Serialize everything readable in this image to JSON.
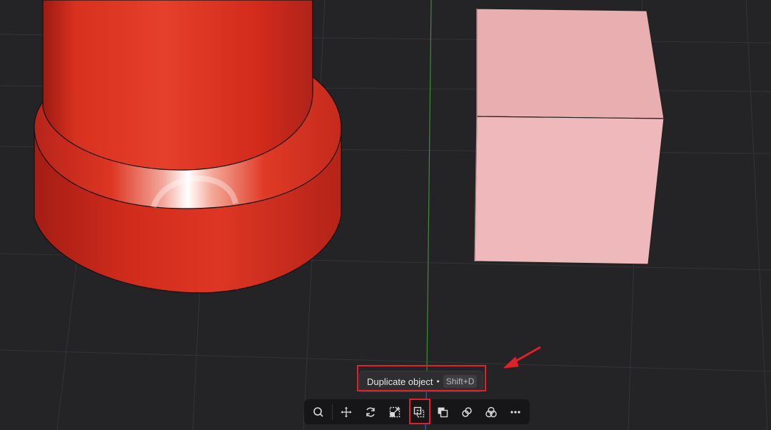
{
  "viewport": {
    "background_color": "#242426",
    "objects": [
      {
        "type": "cylinder-on-base",
        "color": "#e33a2a"
      },
      {
        "type": "cube",
        "color": "#f0b3b5"
      }
    ]
  },
  "tooltip": {
    "label": "Duplicate object",
    "separator": "•",
    "shortcut": "Shift+D"
  },
  "toolbar": {
    "buttons": [
      {
        "name": "search-button",
        "icon": "search-icon"
      },
      {
        "name": "move-button",
        "icon": "move-icon"
      },
      {
        "name": "rotate-button",
        "icon": "rotate-icon"
      },
      {
        "name": "scale-button",
        "icon": "scale-icon"
      },
      {
        "name": "duplicate-button",
        "icon": "duplicate-icon",
        "active": true
      },
      {
        "name": "boolean-button",
        "icon": "boolean-icon"
      },
      {
        "name": "link-button",
        "icon": "link-icon"
      },
      {
        "name": "combine-button",
        "icon": "combine-icon"
      },
      {
        "name": "more-button",
        "icon": "more-icon"
      }
    ]
  },
  "annotation": {
    "color": "#e0202a"
  }
}
